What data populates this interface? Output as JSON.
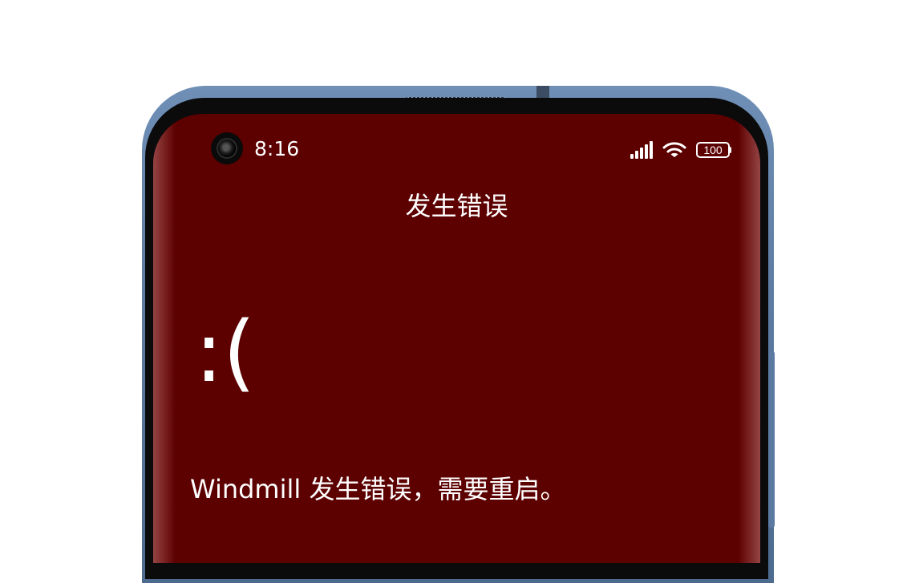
{
  "status_bar": {
    "time": "8:16",
    "battery_level": "100",
    "signal_icon": "cellular-signal-icon",
    "wifi_icon": "wifi-icon",
    "battery_icon": "battery-icon"
  },
  "page": {
    "title": "发生错误",
    "sad_face": ":(",
    "message": "Windmill 发生错误，需要重启。"
  },
  "colors": {
    "screen_background": "#5c0000",
    "phone_frame": "#5f7da3",
    "text": "#ffffff"
  }
}
